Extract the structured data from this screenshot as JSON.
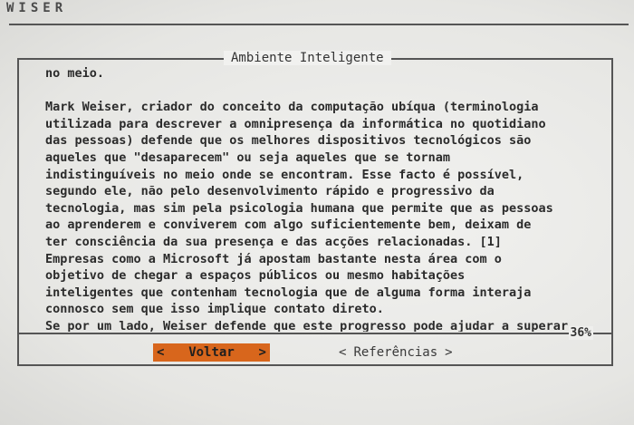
{
  "app": {
    "title": "WISER"
  },
  "dialog": {
    "title": "Ambiente Inteligente",
    "lines": [
      "no meio.",
      "",
      "Mark Weiser, criador do conceito da computação ubíqua (terminologia",
      "utilizada para descrever a omnipresença da informática no quotidiano",
      "das pessoas) defende que os melhores dispositivos tecnológicos são",
      "aqueles que \"desaparecem\" ou seja aqueles que se tornam",
      "indistinguíveis no meio onde se encontram. Esse facto é possível,",
      "segundo ele, não pelo desenvolvimento rápido e progressivo da",
      "tecnologia, mas sim pela psicologia humana que permite que as pessoas",
      "ao aprenderem e conviverem com algo suficientemente bem, deixam de",
      "ter consciência da sua presença e das acções relacionadas. [1]",
      "Empresas como a Microsoft já apostam bastante nesta área com o",
      "objetivo de chegar a espaços públicos ou mesmo habitações",
      "inteligentes que contenham tecnologia que de alguma forma interaja",
      "connosco sem que isso implique contato direto.",
      "Se por um lado, Weiser defende que este progresso pode ajudar a superar"
    ],
    "scroll_percent": "36%"
  },
  "buttons": {
    "back": {
      "label": "Voltar",
      "left_bracket": "<",
      "right_bracket": ">"
    },
    "references": {
      "label": "Referências",
      "left_bracket": "<",
      "right_bracket": ">"
    }
  },
  "colors": {
    "selected_button": "#d8661c",
    "text": "#2b2b2b",
    "border": "#555555"
  }
}
